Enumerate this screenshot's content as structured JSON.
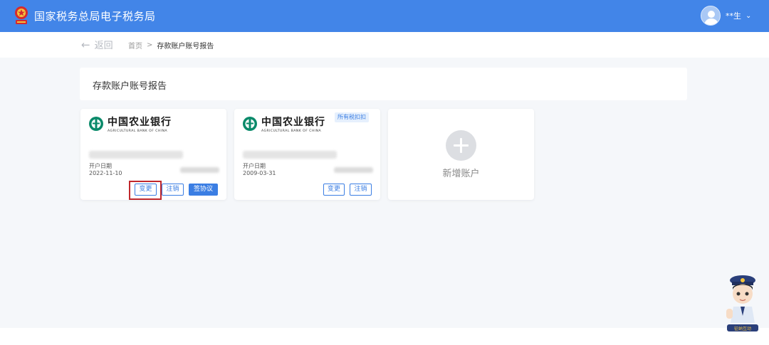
{
  "header": {
    "title": "国家税务总局电子税务局",
    "user_name": "**生",
    "user_chevron": "⌄",
    "emblem_icon": "national-emblem-icon",
    "avatar_icon": "user-avatar-icon",
    "color": "#4285e8"
  },
  "nav": {
    "back_label": "返回",
    "back_icon": "←",
    "breadcrumb": {
      "home": "首页",
      "separator": ">",
      "current": "存款账户账号报告"
    }
  },
  "page": {
    "title": "存款账户账号报告"
  },
  "cards": [
    {
      "bank_name": "中国农业银行",
      "bank_name_en": "AGRICULTURAL BANK OF CHINA",
      "account_number_masked": true,
      "open_date_label": "开户日期",
      "open_date": "2022-11-10",
      "buttons": {
        "change": "变更",
        "cancel": "注销",
        "sign": "签协议"
      },
      "change_highlighted": true
    },
    {
      "bank_name": "中国农业银行",
      "bank_name_en": "AGRICULTURAL BANK OF CHINA",
      "tag": "所有税扣扣",
      "account_number_masked": true,
      "open_date_label": "开户日期",
      "open_date": "2009-03-31",
      "buttons": {
        "change": "变更",
        "cancel": "注销"
      }
    }
  ],
  "add_card": {
    "label": "新增账户",
    "icon": "plus-icon"
  },
  "mascot": {
    "label": "征纳互动",
    "icon": "tax-officer-mascot-icon"
  },
  "colors": {
    "primary": "#3b7ee3",
    "bank_green": "#0a8a6a",
    "highlight_red": "#c0282d"
  }
}
